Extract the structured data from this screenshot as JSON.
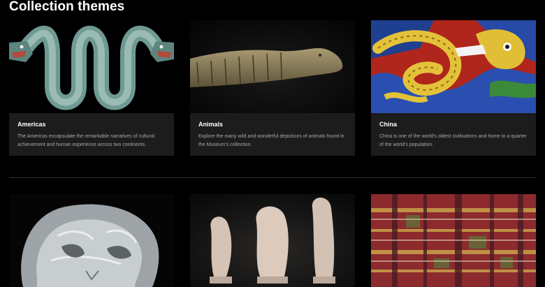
{
  "page": {
    "heading": "Collection themes"
  },
  "row1": [
    {
      "title": "Americas",
      "description": "The Americas encapsulate the remarkable narratives of cultural achievement and human experience across two continents.",
      "image": "double-headed-turquoise-serpent"
    },
    {
      "title": "Animals",
      "description": "Explore the many wild and wonderful depictions of animals found in the Museum's collection.",
      "image": "bronze-crocodile"
    },
    {
      "title": "China",
      "description": "China is one of the world's oldest civilisations and home to a quarter of the world's population.",
      "image": "ceramic-dragon-tile"
    }
  ],
  "row2": [
    {
      "image": "crystal-skull"
    },
    {
      "image": "clay-figurines"
    },
    {
      "image": "kente-cloth"
    }
  ]
}
